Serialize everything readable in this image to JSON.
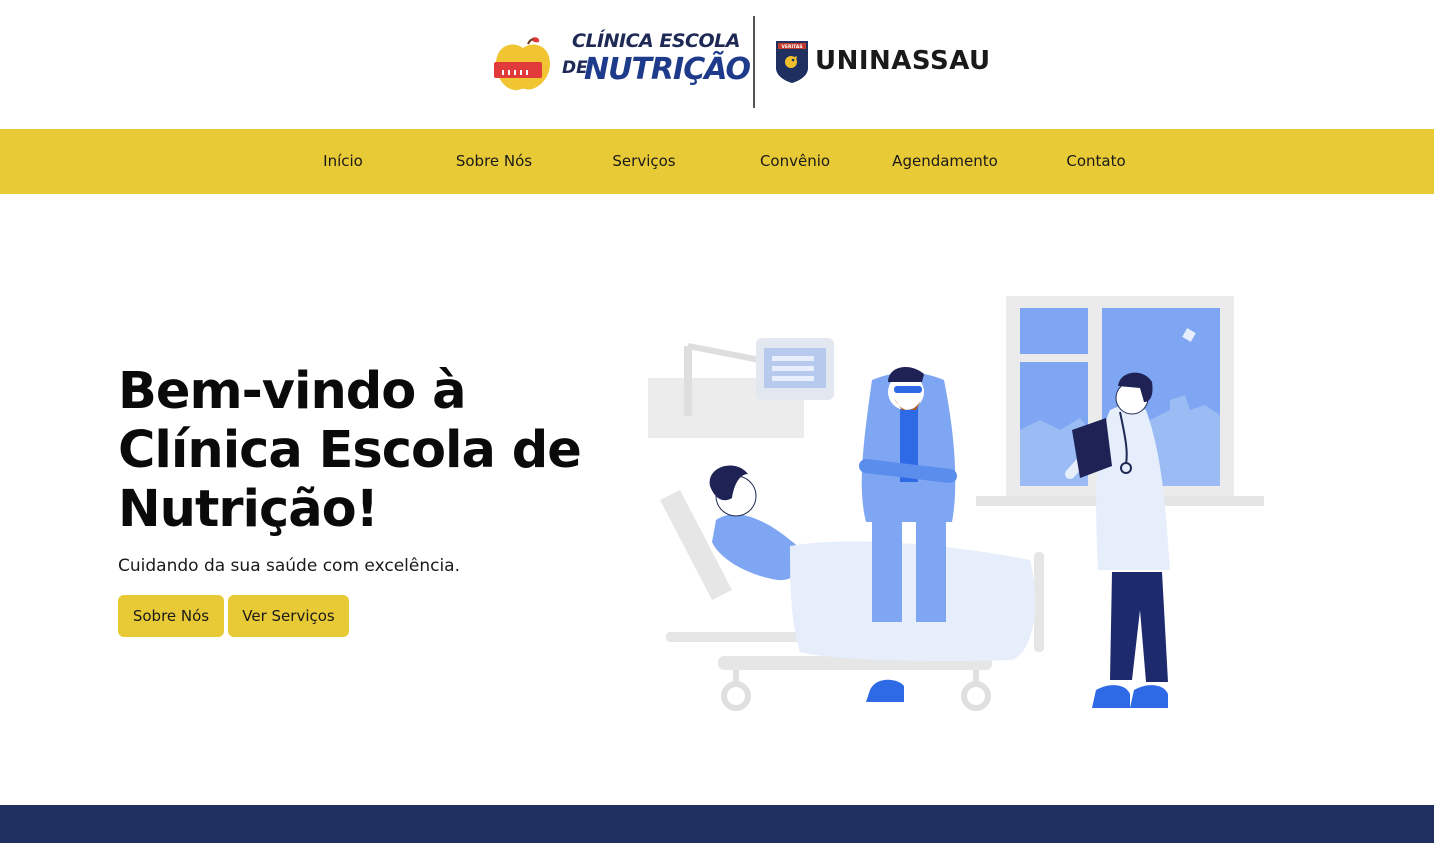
{
  "brand": {
    "clinic_line1": "CLÍNICA ESCOLA",
    "clinic_de": "DE",
    "clinic_line2": "NUTRIÇÃO",
    "university": "UNINASSAU",
    "shield_text": "VERITAS",
    "accent_color": "#e8c936",
    "navy_color": "#1f3060"
  },
  "nav": {
    "items": [
      {
        "label": "Início"
      },
      {
        "label": "Sobre Nós"
      },
      {
        "label": "Serviços"
      },
      {
        "label": "Convênio"
      },
      {
        "label": "Agendamento"
      },
      {
        "label": "Contato"
      }
    ]
  },
  "hero": {
    "title": "Bem-vindo à Clínica Escola de Nutrição!",
    "subtitle": "Cuidando da sua saúde com excelência.",
    "button_about": "Sobre Nós",
    "button_services": "Ver Serviços"
  },
  "icons": {
    "logo": "apple-ruler-icon",
    "shield": "uninassau-shield-icon",
    "illustration": "hospital-consultation-illustration"
  }
}
